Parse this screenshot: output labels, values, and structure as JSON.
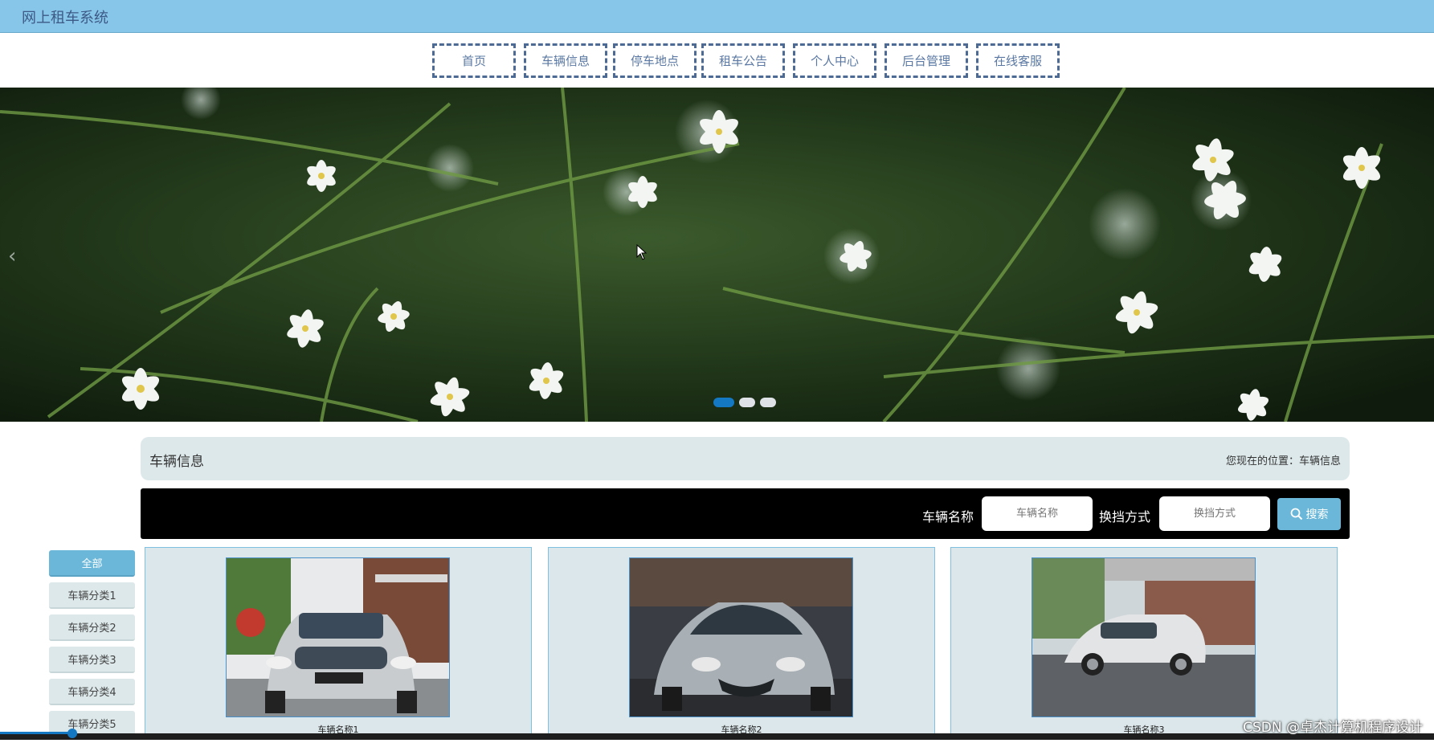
{
  "app": {
    "title": "网上租车系统"
  },
  "nav": {
    "items": [
      {
        "label": "首页"
      },
      {
        "label": "车辆信息"
      },
      {
        "label": "停车地点"
      },
      {
        "label": "租车公告"
      },
      {
        "label": "个人中心"
      },
      {
        "label": "后台管理"
      },
      {
        "label": "在线客服"
      }
    ]
  },
  "banner": {
    "prev_icon": "chevron-left-icon",
    "slide_count": 3,
    "active_slide": 1
  },
  "section": {
    "heading": "车辆信息",
    "location_label": "您现在的位置：",
    "location_value": "车辆信息"
  },
  "search": {
    "name_label": "车辆名称",
    "name_placeholder": "车辆名称",
    "gear_label": "换挡方式",
    "gear_placeholder": "换挡方式",
    "button_label": "搜索",
    "button_icon": "search-icon"
  },
  "categories": [
    {
      "label": "全部",
      "active": true
    },
    {
      "label": "车辆分类1"
    },
    {
      "label": "车辆分类2"
    },
    {
      "label": "车辆分类3"
    },
    {
      "label": "车辆分类4"
    },
    {
      "label": "车辆分类5"
    }
  ],
  "vehicles": [
    {
      "name": "车辆名称1"
    },
    {
      "name": "车辆名称2"
    },
    {
      "name": "车辆名称3"
    }
  ],
  "watermark": "CSDN @卓杰计算机程序设计",
  "colors": {
    "topbar": "#87c6e8",
    "accent": "#6ab7d9",
    "nav_border": "#4d6a95",
    "panel": "#dde8ea",
    "active_dot": "#1479c2"
  }
}
